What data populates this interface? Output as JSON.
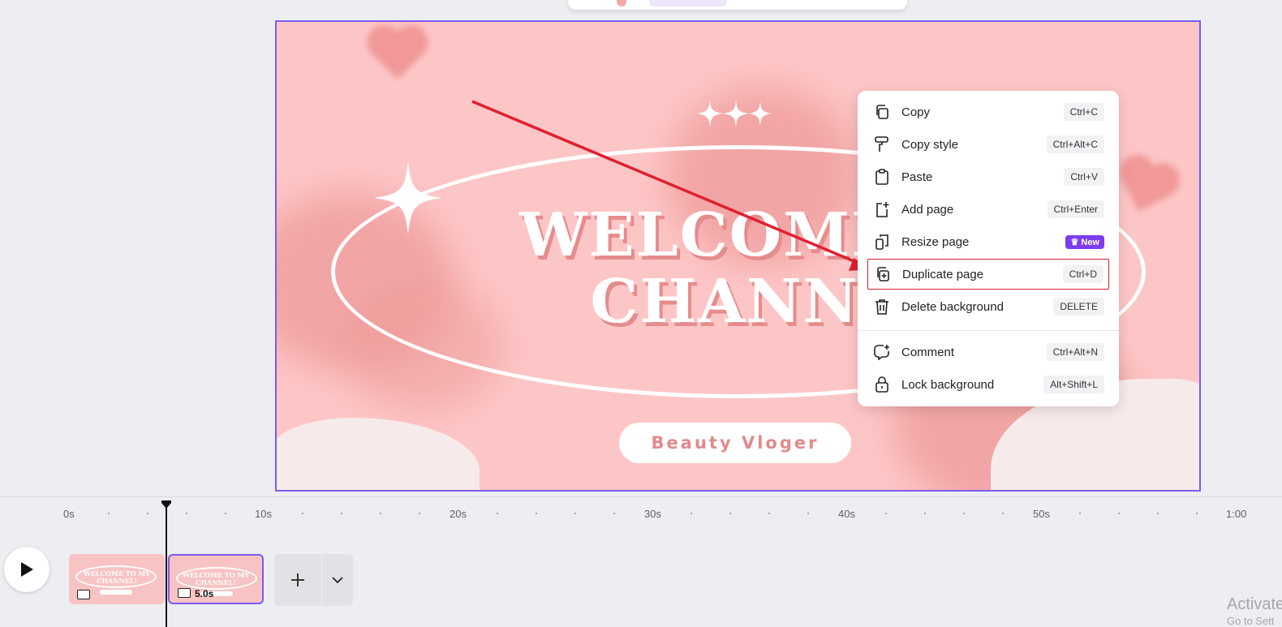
{
  "design": {
    "title_line1": "WELCOME TO",
    "title_line2": "CHANNEL",
    "subtitle": "Beauty Vloger"
  },
  "context_menu": {
    "items": [
      {
        "label": "Copy",
        "shortcut": "Ctrl+C",
        "icon": "copy-icon"
      },
      {
        "label": "Copy style",
        "shortcut": "Ctrl+Alt+C",
        "icon": "paint-roller-icon"
      },
      {
        "label": "Paste",
        "shortcut": "Ctrl+V",
        "icon": "clipboard-icon"
      },
      {
        "label": "Add page",
        "shortcut": "Ctrl+Enter",
        "icon": "add-page-icon"
      },
      {
        "label": "Resize page",
        "badge": "New",
        "icon": "resize-icon"
      },
      {
        "label": "Duplicate page",
        "shortcut": "Ctrl+D",
        "icon": "duplicate-icon",
        "highlighted": true
      },
      {
        "label": "Delete background",
        "shortcut": "DELETE",
        "icon": "trash-icon"
      },
      {
        "label": "Comment",
        "shortcut": "Ctrl+Alt+N",
        "icon": "comment-add-icon"
      },
      {
        "label": "Lock background",
        "shortcut": "Alt+Shift+L",
        "icon": "lock-icon"
      }
    ]
  },
  "timeline": {
    "ruler_labels": [
      "0s",
      "10s",
      "20s",
      "30s",
      "40s",
      "50s",
      "1:00"
    ],
    "pages": [
      {
        "text": "WELCOME TO MY CHANNEL!",
        "duration": ""
      },
      {
        "text": "WELCOME TO MY CHANNEL!",
        "duration": "5.0s"
      }
    ]
  },
  "watermark": {
    "line1": "Activate",
    "line2": "Go to Sett"
  },
  "colors": {
    "canvas_bg": "#fdc6c6",
    "selection": "#7c5bf0",
    "accent_badge": "#7d3cf0",
    "annotation": "#e02030"
  }
}
